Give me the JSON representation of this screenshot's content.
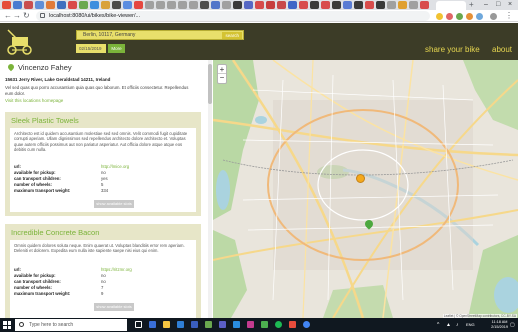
{
  "browser": {
    "url": "localhost:8080/ui/bikes/bike-viewer/...",
    "new_tab_label": "+",
    "window_controls": [
      "–",
      "□",
      "×"
    ]
  },
  "header": {
    "search_value": "Berlin, 10117, Germany",
    "search_button": "search",
    "date_value": "02/15/2019",
    "more_button": "More",
    "nav_links": [
      "share your bike",
      "about"
    ]
  },
  "host": {
    "name": "Vincenzo Fahey",
    "address": "15631 Jerry River, Lake Geraldstad 14211, Ireland",
    "description": "Vel sed quas quo porro accusantium quia quas quo laborum. Et officiis consectetur. Repellendus eum dolor.",
    "homepage_link": "Visit this locations homepage"
  },
  "bikes": [
    {
      "title": "Sleek Plastic Towels",
      "description": "Architecto est id quidem accusantium molestiae sed sed omnis. Velit commodi fugit cupiditate corrupti aperiam. Ullam dignissimos sed repellendus architecto dolore architecto et. Voluptas quae autem officiis possimus aut non pariatur asperiatur. Aut officia dolore atque atque eos debitis cum nulla.",
      "attributes": [
        {
          "label": "url:",
          "value": "http://lmice.org"
        },
        {
          "label": "available for pickup:",
          "value": "no"
        },
        {
          "label": "can transport children:",
          "value": "yes"
        },
        {
          "label": "number of wheels:",
          "value": "5"
        },
        {
          "label": "maximum transport weight:",
          "value": "334"
        }
      ],
      "button": "show available slots"
    },
    {
      "title": "Incredible Concrete Bacon",
      "description": "Omnis quidem dolores soluta neque. Enim quaerat ut. Voluptas blanditiis error rem aperiam. Deleniti et dolorem. Expedita eum nulla iste sapiente saepe nisi eius qui enim.",
      "attributes": [
        {
          "label": "url:",
          "value": "https://ritzmr.org"
        },
        {
          "label": "available for pickup:",
          "value": "no"
        },
        {
          "label": "can transport children:",
          "value": "no"
        },
        {
          "label": "number of wheels:",
          "value": "7"
        },
        {
          "label": "maximum transport weight:",
          "value": "9"
        }
      ],
      "button": "show available slots"
    }
  ],
  "map": {
    "zoom_in": "+",
    "zoom_out": "−",
    "attribution": "Leaflet | © OpenStreetMap contributors, CC-BY-SA"
  },
  "taskbar": {
    "search_placeholder": "Type here to search",
    "time": "11:18 AM",
    "date": "2/15/2019",
    "language": "ENG"
  },
  "colors": {
    "header_bg": "#3c3c27",
    "accent_yellow": "#e8df6b",
    "accent_green": "#7bb33a",
    "card_bg": "#e7e6c8",
    "map_marker_orange": "#f4a91c"
  }
}
